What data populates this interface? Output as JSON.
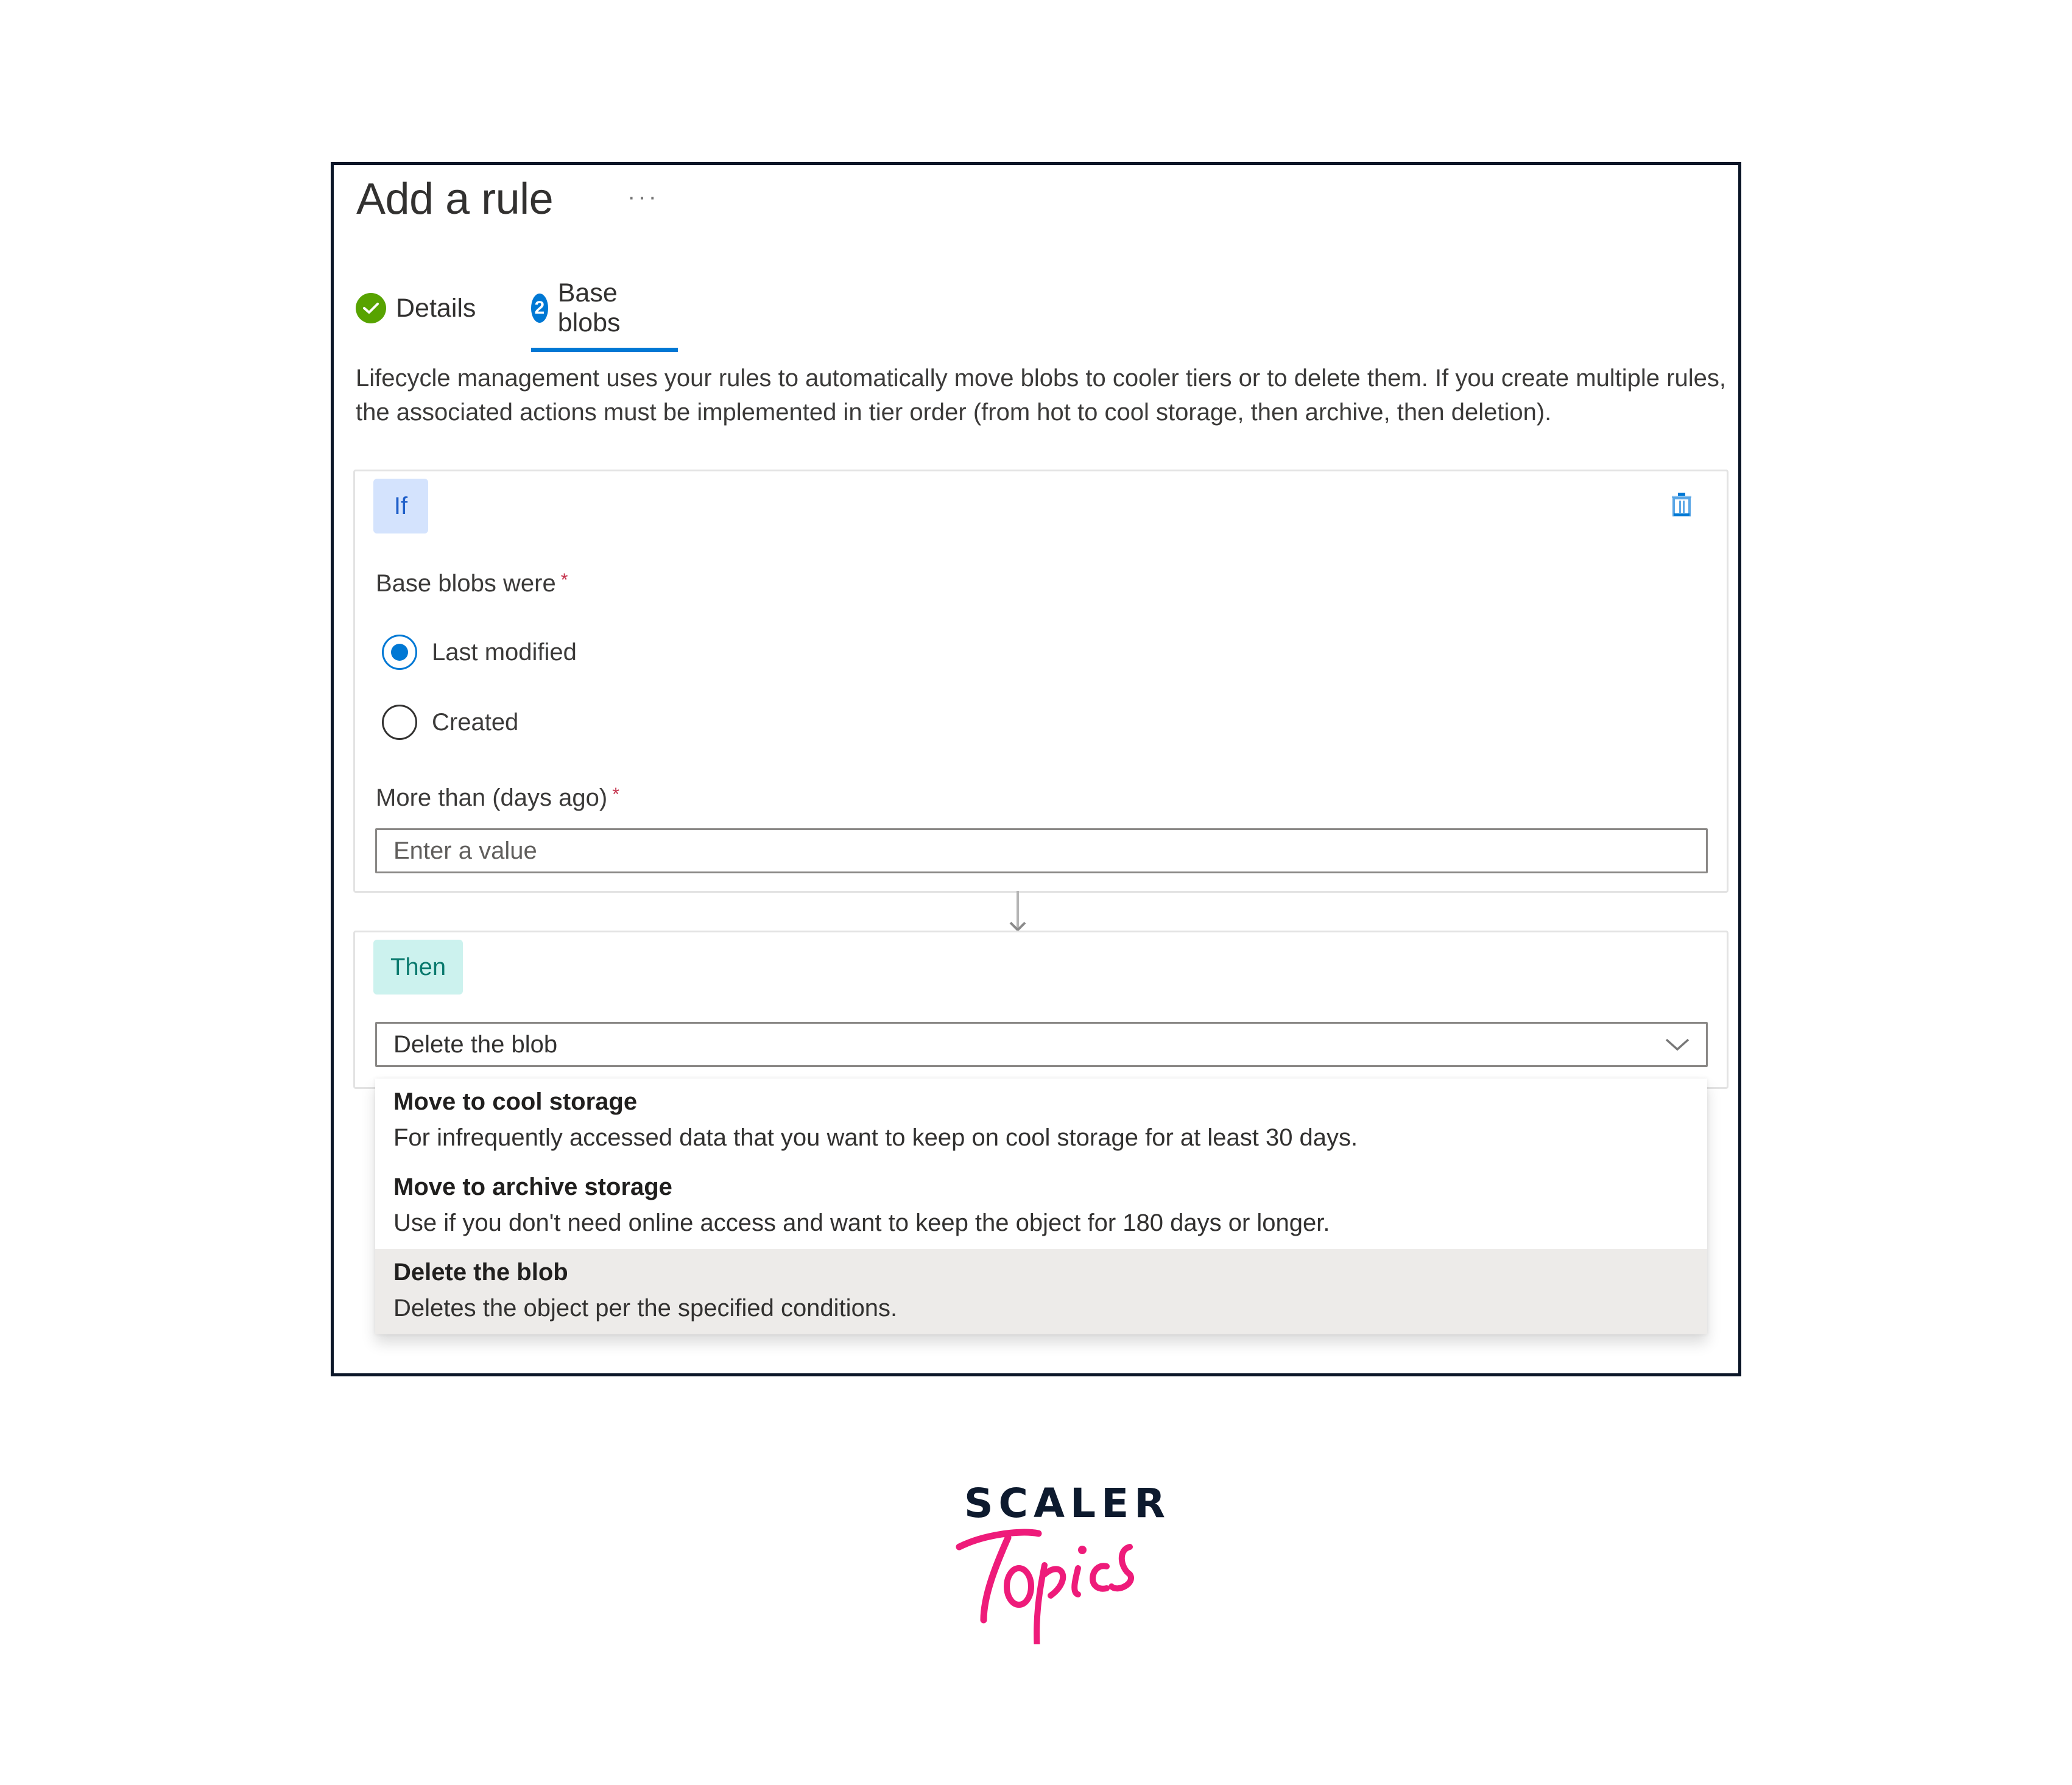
{
  "panel": {
    "title": "Add a rule",
    "more_label": "···",
    "tabs": [
      {
        "label": "Details",
        "state": "completed",
        "icon": "check-icon"
      },
      {
        "label": "Base blobs",
        "state": "active",
        "step": "2"
      }
    ],
    "description": "Lifecycle management uses your rules to automatically move blobs to cooler tiers or to delete them. If you create multiple rules, the associated actions must be implemented in tier order (from hot to cool storage, then archive, then deletion)."
  },
  "if_block": {
    "badge": "If",
    "delete_icon": "trash-icon",
    "base_blobs_label": "Base blobs were",
    "required_mark": "*",
    "radio_options": [
      {
        "label": "Last modified",
        "checked": true
      },
      {
        "label": "Created",
        "checked": false
      }
    ],
    "days_label": "More than (days ago)",
    "days_value": "",
    "days_placeholder": "Enter a value"
  },
  "then_block": {
    "badge": "Then",
    "selected_action": "Delete the blob",
    "options": [
      {
        "title": "Move to cool storage",
        "description": "For infrequently accessed data that you want to keep on cool storage for at least 30 days."
      },
      {
        "title": "Move to archive storage",
        "description": "Use if you don't need online access and want to keep the object for 180 days or longer."
      },
      {
        "title": "Delete the blob",
        "description": "Deletes the object per the specified conditions.",
        "selected": true
      }
    ]
  },
  "branding": {
    "line1": "SCALER",
    "line2": "Topics",
    "colors": {
      "dark": "#0d1a2e",
      "pink": "#ee1b7a"
    }
  },
  "colors": {
    "accent": "#0078d4",
    "success": "#57a300",
    "if_badge_bg": "#d4e3fd",
    "then_badge_bg": "#ccf2ee",
    "selected_option_bg": "#edebe9"
  }
}
